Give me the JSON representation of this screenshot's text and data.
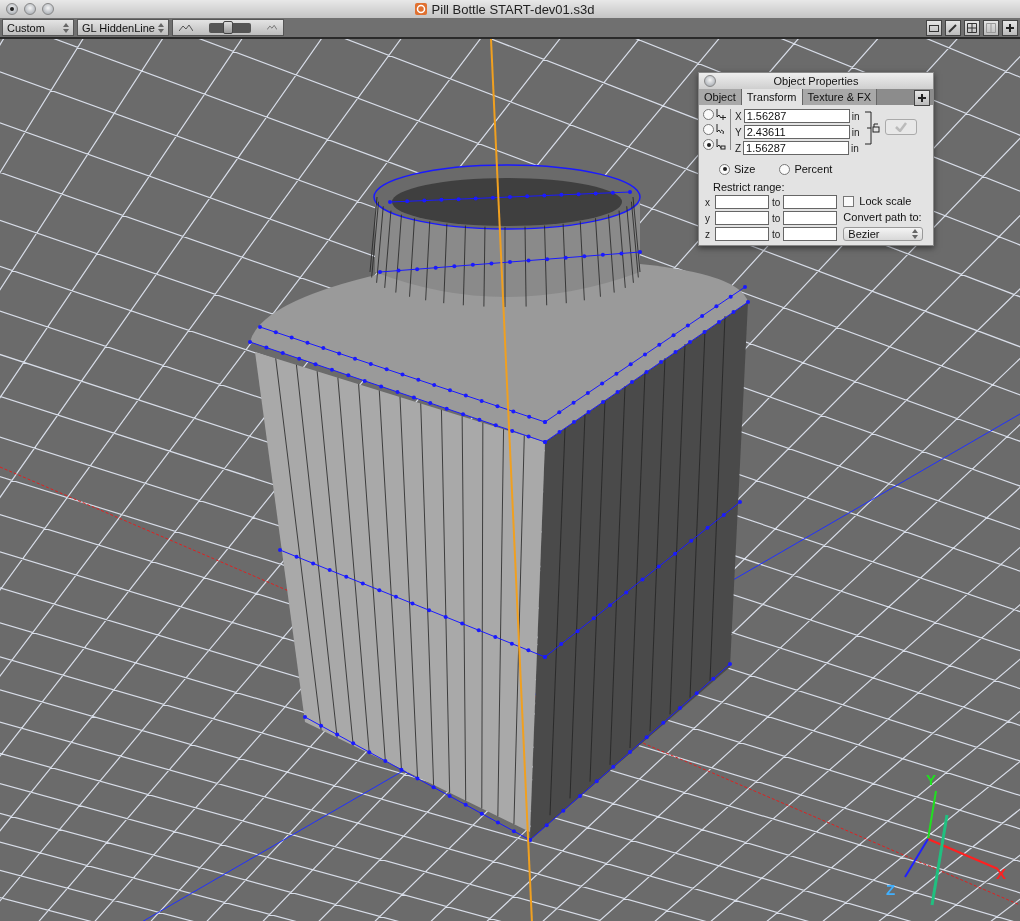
{
  "window": {
    "title": "Pill Bottle START-dev01.s3d"
  },
  "toolbar": {
    "view_mode": "Custom",
    "render_mode": "GL HiddenLine",
    "zoom": {
      "level": 0.45
    }
  },
  "panel": {
    "title": "Object Properties",
    "tabs": [
      {
        "label": "Object",
        "selected": false
      },
      {
        "label": "Transform",
        "selected": true
      },
      {
        "label": "Texture & FX",
        "selected": false
      }
    ],
    "transform_modes": [
      {
        "kind": "move",
        "selected": false
      },
      {
        "kind": "rotate",
        "selected": false
      },
      {
        "kind": "scale",
        "selected": true
      }
    ],
    "coords": [
      {
        "axis": "X",
        "value": "1.56287",
        "unit": "in"
      },
      {
        "axis": "Y",
        "value": "2.43611",
        "unit": "in"
      },
      {
        "axis": "Z",
        "value": "1.56287",
        "unit": "in"
      }
    ],
    "scale_modes": [
      {
        "label": "Size",
        "selected": true
      },
      {
        "label": "Percent",
        "selected": false
      }
    ],
    "restrict_label": "Restrict range:",
    "ranges": [
      {
        "axis": "x",
        "to": "to"
      },
      {
        "axis": "y",
        "to": "to"
      },
      {
        "axis": "z",
        "to": "to"
      }
    ],
    "lock_scale": {
      "label": "Lock scale",
      "checked": false
    },
    "convert_label": "Convert path to:",
    "convert_value": "Bezier"
  },
  "axes": {
    "x": "X",
    "y": "Y",
    "z": "Z"
  }
}
